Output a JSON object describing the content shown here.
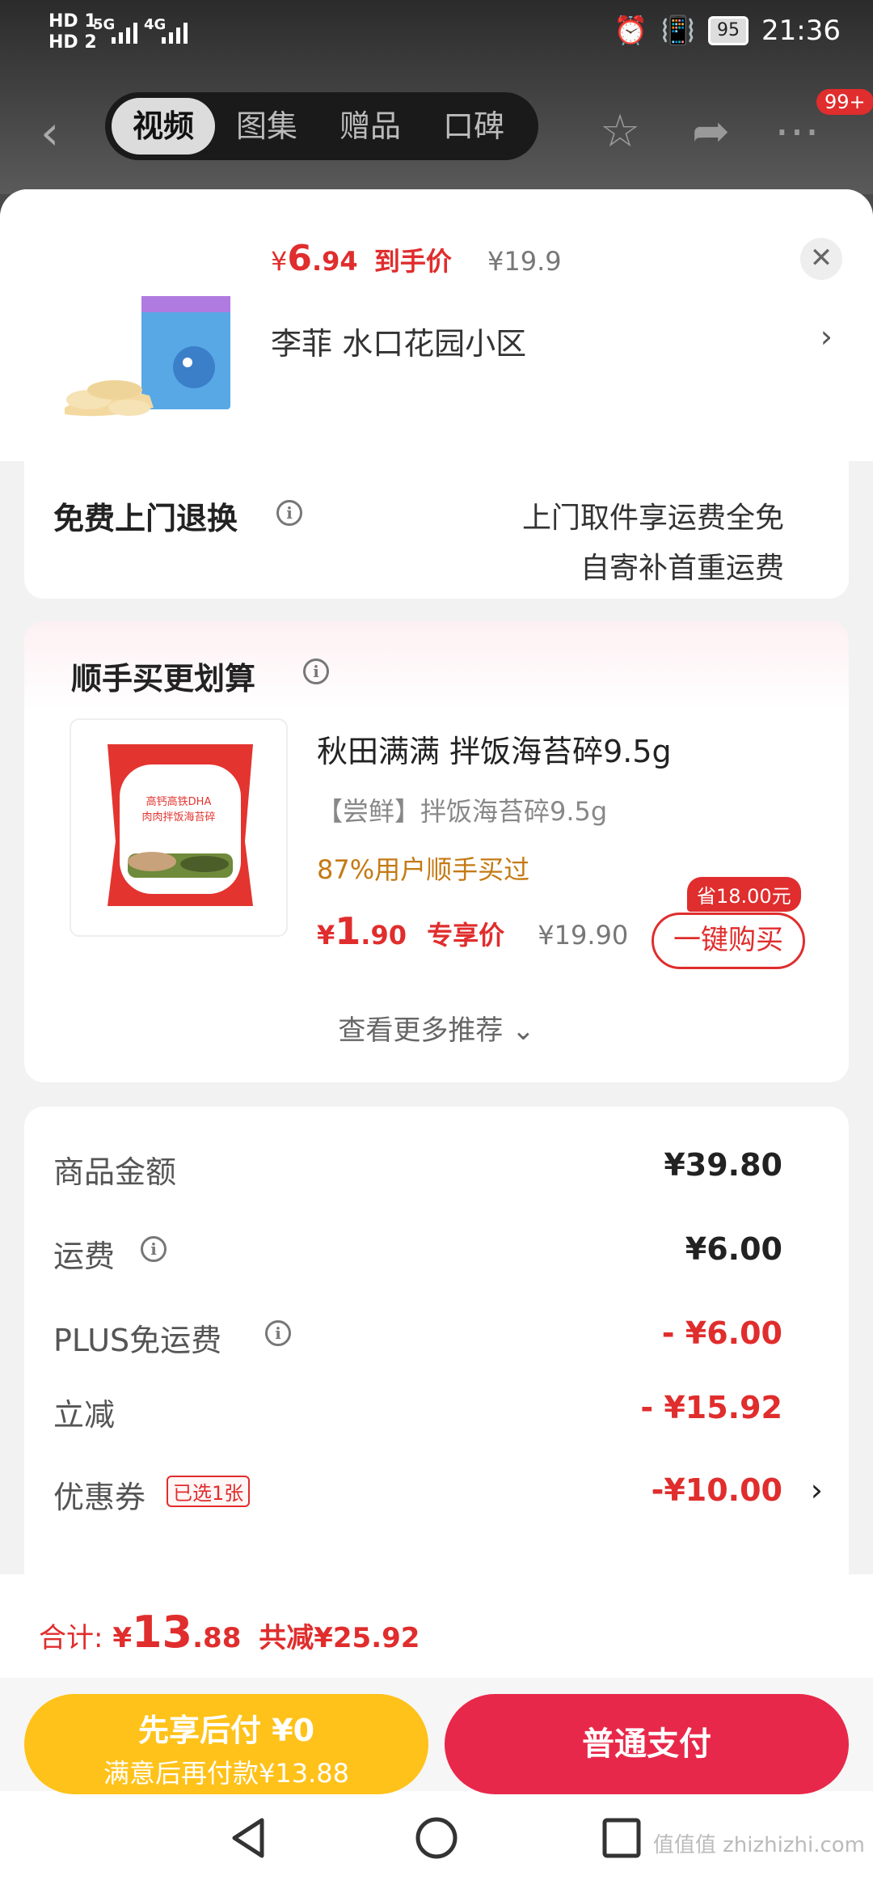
{
  "status_bar": {
    "hd1": "HD 1",
    "hd2": "HD 2",
    "net1": "5G",
    "net2": "4G",
    "battery": "95",
    "time": "21:36"
  },
  "nav": {
    "tabs": [
      "视频",
      "图集",
      "赠品",
      "口碑"
    ],
    "active_tab": "视频",
    "badge": "99+"
  },
  "order": {
    "price_symbol": "¥",
    "price_int": "6",
    "price_dec": ".94",
    "price_label": "到手价",
    "original_price": "¥19.9",
    "address": "李菲  水口花园小区"
  },
  "return": {
    "title": "免费上门退换",
    "line1": "上门取件享运费全免",
    "line2": "自寄补首重运费"
  },
  "recommend": {
    "title": "顺手买更划算",
    "name": "秋田满满 拌饭海苔碎9.5g",
    "tag": "【尝鲜】拌饭海苔碎9.5g",
    "percent": "87%用户顺手买过",
    "price_symbol": "¥",
    "price_int": "1",
    "price_dec": ".90",
    "price_label": "专享价",
    "original_price": "¥19.90",
    "save_badge": "省18.00元",
    "buy_button": "一键购买",
    "more": "查看更多推荐",
    "package_text1": "高钙高铁DHA",
    "package_text2": "肉肉拌饭海苔碎"
  },
  "summary": {
    "rows": [
      {
        "label": "商品金额",
        "value": "¥39.80"
      },
      {
        "label": "运费",
        "value": "¥6.00"
      },
      {
        "label": "PLUS免运费",
        "value": "- ¥6.00"
      },
      {
        "label": "立减",
        "value": "- ¥15.92"
      },
      {
        "label": "优惠券",
        "value": "-¥10.00",
        "tag": "已选1张"
      }
    ]
  },
  "footer": {
    "total_label": "合计:",
    "total_symbol": "¥",
    "total_int": "13",
    "total_dec": ".88",
    "total_saved": "共减¥25.92",
    "later_title": "先享后付 ¥0",
    "later_sub": "满意后再付款¥13.88",
    "pay_button": "普通支付"
  },
  "watermark": "值值值 zhizhizhi.com",
  "colors": {
    "accent_red": "#e02d2d",
    "pay_red": "#e8284a",
    "later_yellow": "#ffc21a",
    "hint_orange": "#c47a14"
  }
}
